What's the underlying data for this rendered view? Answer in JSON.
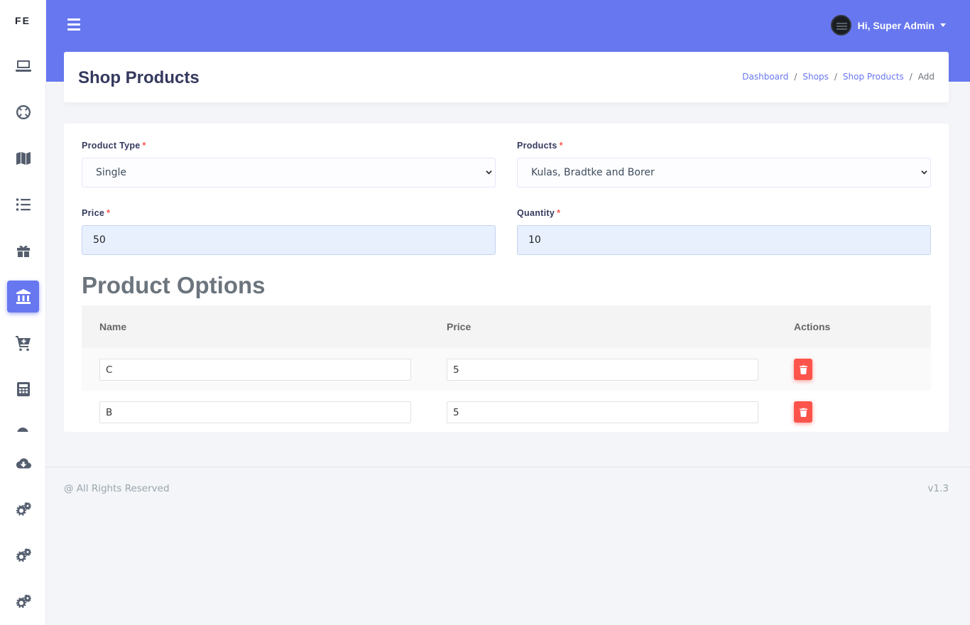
{
  "brand": {
    "logo_text": "FE"
  },
  "sidebar": {
    "items": [
      {
        "icon": "laptop-icon"
      },
      {
        "icon": "life-ring-icon"
      },
      {
        "icon": "map-icon"
      },
      {
        "icon": "list-icon"
      },
      {
        "icon": "gift-icon"
      },
      {
        "icon": "university-icon",
        "active": true
      },
      {
        "icon": "cart-plus-icon"
      },
      {
        "icon": "calculator-icon"
      },
      {
        "icon": "cloud-download-icon"
      },
      {
        "icon": "cogs-icon"
      },
      {
        "icon": "cogs-icon"
      },
      {
        "icon": "cogs-icon"
      }
    ]
  },
  "topbar": {
    "user_greeting": "Hi, Super Admin"
  },
  "header": {
    "title": "Shop Products",
    "breadcrumb": [
      "Dashboard",
      "Shops",
      "Shop Products",
      "Add"
    ]
  },
  "form": {
    "product_type": {
      "label": "Product Type",
      "value": "Single"
    },
    "products": {
      "label": "Products",
      "value": "Kulas, Bradtke and Borer"
    },
    "price": {
      "label": "Price",
      "value": "50"
    },
    "quantity": {
      "label": "Quantity",
      "value": "10"
    },
    "required_mark": "*"
  },
  "options": {
    "title": "Product Options",
    "columns": [
      "Name",
      "Price",
      "Actions"
    ],
    "rows": [
      {
        "name": "C",
        "price": "5"
      },
      {
        "name": "B",
        "price": "5"
      }
    ]
  },
  "footer": {
    "left": "@ All Rights Reserved",
    "right": "v1.3"
  },
  "colors": {
    "accent": "#6777ef",
    "danger": "#fc544b",
    "sidebar_icon": "#545e6e"
  }
}
